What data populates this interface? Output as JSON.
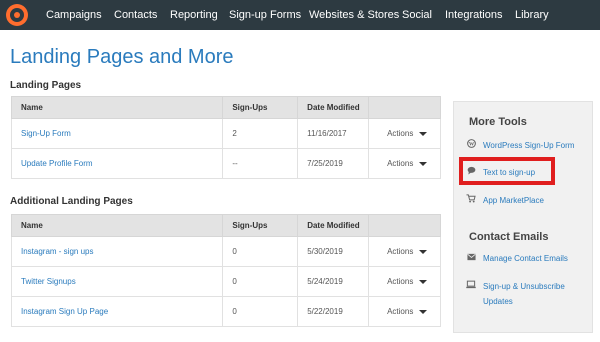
{
  "nav": {
    "items": [
      "Campaigns",
      "Contacts",
      "Reporting",
      "Sign-up Forms",
      "Websites & Stores",
      "Social",
      "Integrations",
      "Library"
    ]
  },
  "page_title": "Landing Pages and More",
  "landing": {
    "title": "Landing Pages",
    "headers": [
      "Name",
      "Sign-Ups",
      "Date Modified",
      ""
    ],
    "rows": [
      {
        "name": "Sign-Up Form",
        "signups": "2",
        "date": "11/16/2017",
        "action": "Actions"
      },
      {
        "name": "Update Profile Form",
        "signups": "--",
        "date": "7/25/2019",
        "action": "Actions"
      }
    ]
  },
  "additional": {
    "title": "Additional Landing Pages",
    "headers": [
      "Name",
      "Sign-Ups",
      "Date Modified",
      ""
    ],
    "rows": [
      {
        "name": "Instagram - sign ups",
        "signups": "0",
        "date": "5/30/2019",
        "action": "Actions"
      },
      {
        "name": "Twitter Signups",
        "signups": "0",
        "date": "5/24/2019",
        "action": "Actions"
      },
      {
        "name": "Instagram Sign Up Page",
        "signups": "0",
        "date": "5/22/2019",
        "action": "Actions"
      }
    ]
  },
  "more_tools": {
    "title": "More Tools",
    "items": [
      {
        "label": "WordPress Sign-Up Form",
        "icon": "wordpress-icon"
      },
      {
        "label": "Text to sign-up",
        "icon": "chat-bubble-icon"
      },
      {
        "label": "App MarketPlace",
        "icon": "cart-icon"
      }
    ]
  },
  "contact_emails": {
    "title": "Contact Emails",
    "items": [
      {
        "label": "Manage Contact Emails",
        "icon": "email-icon"
      },
      {
        "label": "Sign-up & Unsubscribe",
        "label2": "Updates",
        "icon": "laptop-icon"
      }
    ]
  },
  "colors": {
    "nav_bg": "#2d3a41",
    "logo": "#ff6d2e",
    "link": "#2a7bbd",
    "highlight": "#e01e1e"
  }
}
